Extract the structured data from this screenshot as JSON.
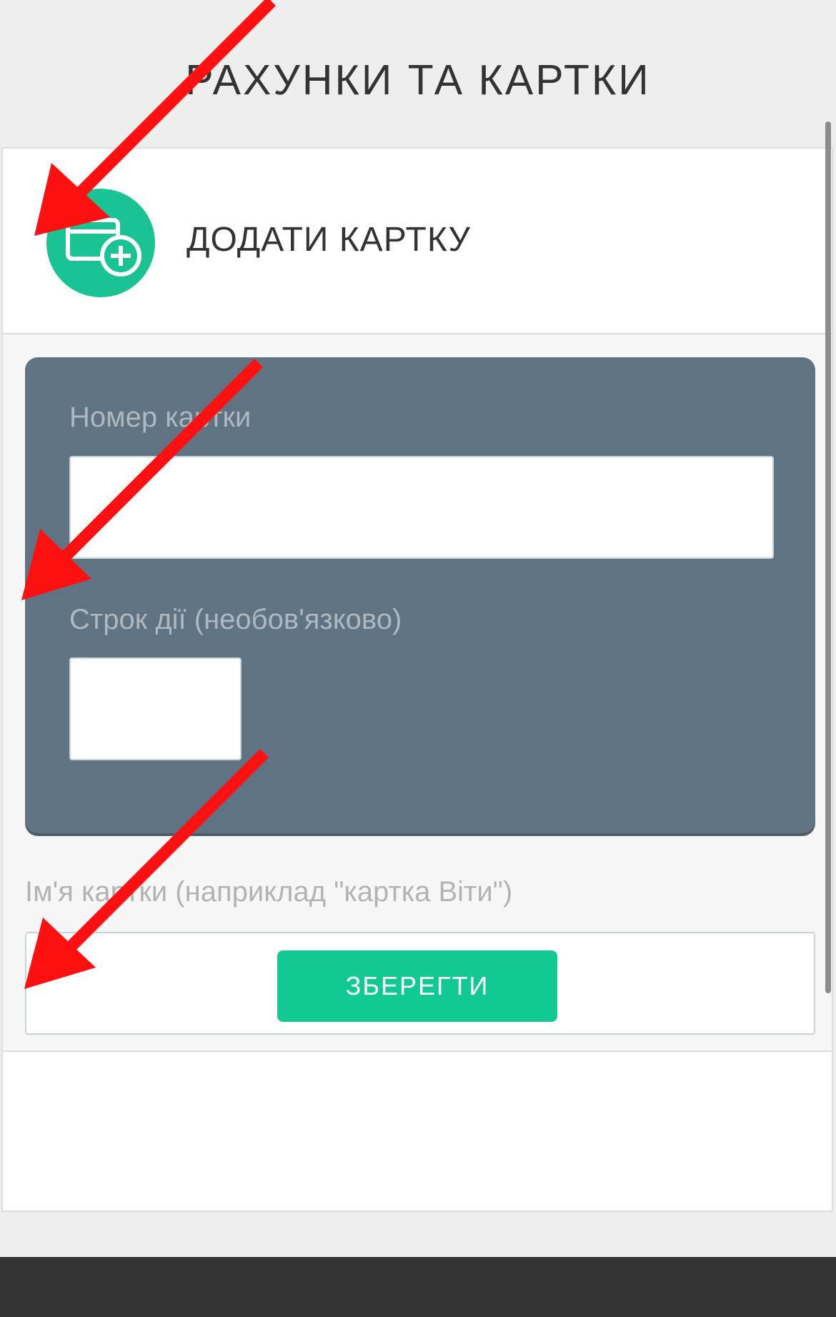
{
  "header": {
    "title": "РАХУНКИ ТА КАРТКИ"
  },
  "add_card": {
    "label": "ДОДАТИ КАРТКУ",
    "icon": "add-card-icon"
  },
  "card_form": {
    "number_label": "Номер картки",
    "number_value": "",
    "expiry_label": "Строк дії (необов'язково)",
    "expiry_value": ""
  },
  "card_name": {
    "label": "Ім'я картки (наприклад \"картка Віти\")",
    "value": ""
  },
  "actions": {
    "save_label": "ЗБЕРЕГТИ"
  },
  "colors": {
    "accent": "#13c993",
    "card_bg": "#607383",
    "annotation_arrow": "#ff0000"
  }
}
